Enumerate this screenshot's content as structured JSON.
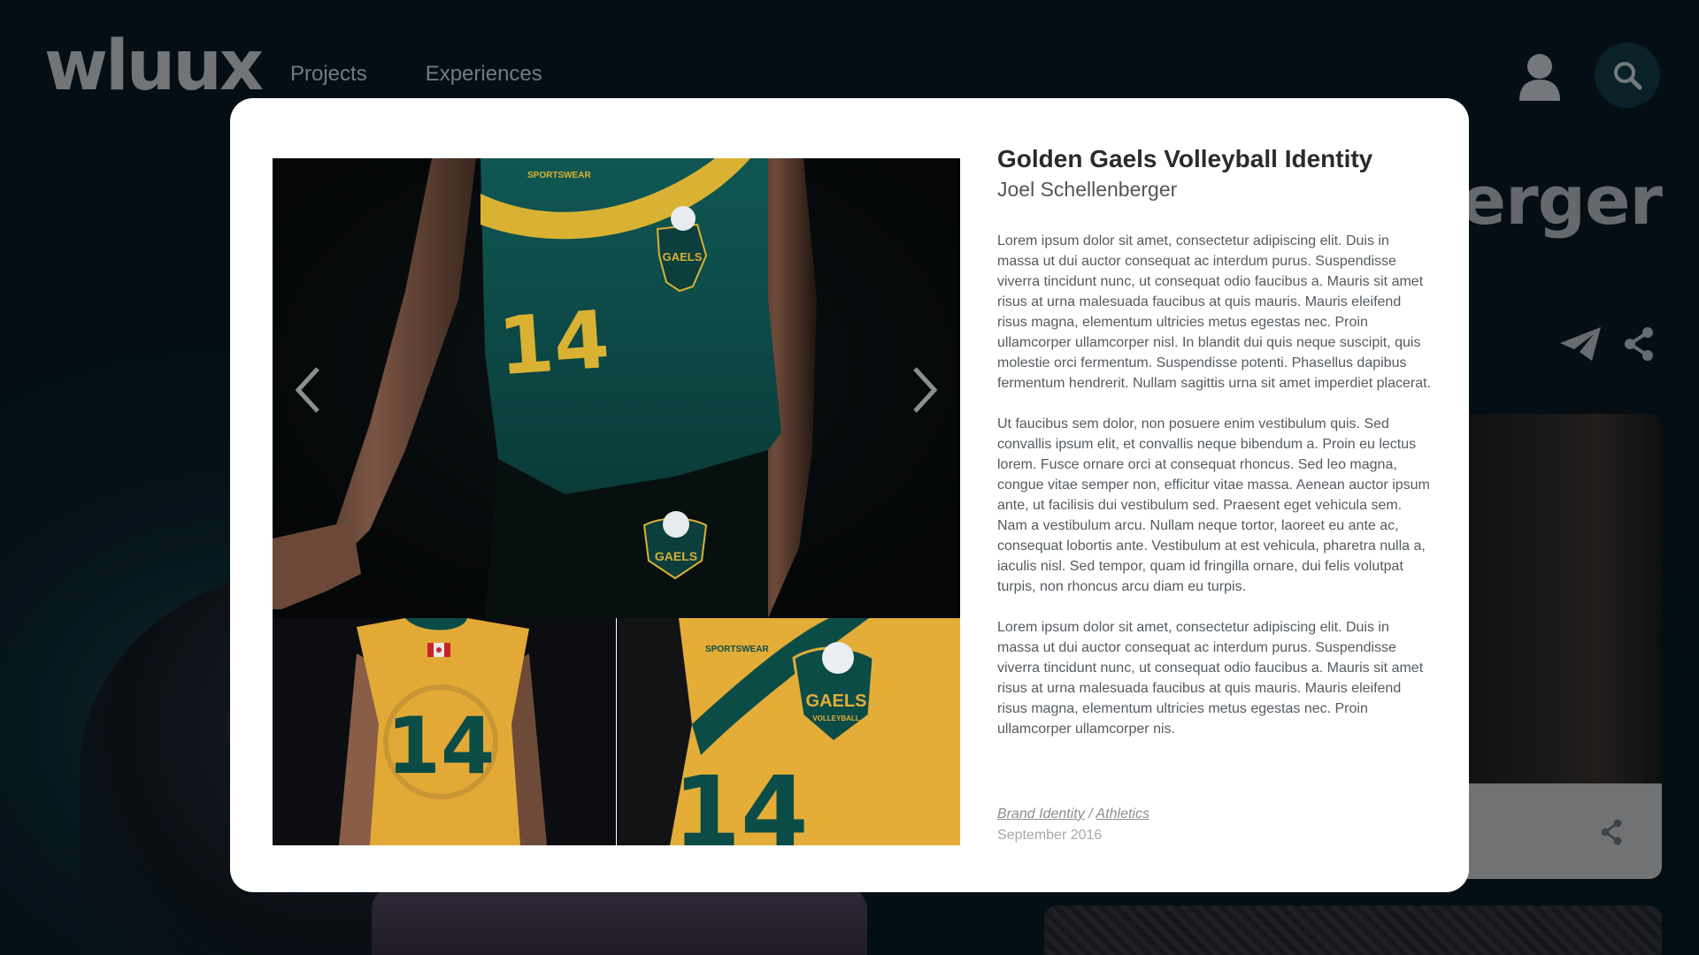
{
  "header": {
    "logo_text": "wluux",
    "nav": [
      {
        "label": "Projects"
      },
      {
        "label": "Experiences"
      }
    ]
  },
  "background": {
    "profile_name_fragment": "berger"
  },
  "modal": {
    "title": "Golden Gaels Volleyball Identity",
    "author": "Joel Schellenberger",
    "paragraphs": [
      "Lorem ipsum dolor sit amet, consectetur adipiscing elit. Duis in massa ut dui auctor consequat ac interdum purus. Suspendisse viverra tincidunt nunc, ut consequat odio faucibus a. Mauris sit amet risus at urna malesuada faucibus at quis mauris. Mauris eleifend risus magna, elementum ultricies metus egestas nec. Proin ullamcorper ullamcorper nisl. In blandit dui quis neque suscipit, quis molestie orci fermentum. Suspendisse potenti. Phasellus dapibus fermentum hendrerit. Nullam sagittis urna sit amet imperdiet placerat.",
      "Ut faucibus sem dolor, non posuere enim vestibulum quis. Sed convallis ipsum elit, et convallis neque bibendum a. Proin eu lectus lorem. Fusce ornare orci at consequat rhoncus. Sed leo magna, congue vitae semper non, efficitur vitae massa. Aenean auctor ipsum ante, ut facilisis dui vestibulum sed. Praesent eget vehicula sem. Nam a vestibulum arcu. Nullam neque tortor, laoreet eu ante ac, consequat lobortis ante. Vestibulum at est vehicula, pharetra nulla a, iaculis nisl. Sed tempor, quam id fringilla ornare, dui felis volutpat turpis, non rhoncus arcu diam eu turpis.",
      "Lorem ipsum dolor sit amet, consectetur adipiscing elit. Duis in massa ut dui auctor consequat ac interdum purus. Suspendisse viverra tincidunt nunc, ut consequat odio faucibus a. Mauris sit amet risus at urna malesuada faucibus at quis mauris. Mauris eleifend risus magna, elementum ultricies metus egestas nec. Proin ullamcorper ullamcorper nis."
    ],
    "tags": [
      "Brand Identity",
      "Athletics"
    ],
    "tag_separator": "/",
    "date": "September 2016",
    "gallery": {
      "main_jersey_number": "14",
      "thumb_left_jersey_number": "14",
      "thumb_right_jersey_number": "14",
      "crest_text": "GAELS",
      "crest_subtext": "VOLLEYBALL",
      "brand_text": "SPORTSWEAR"
    }
  },
  "colors": {
    "jersey_green": "#0b4a48",
    "jersey_gold": "#e9b23a",
    "page_bg": "#04111a",
    "modal_bg": "#ffffff"
  },
  "icons": {
    "user": "user-icon",
    "search": "search-icon",
    "send": "send-icon",
    "share": "share-icon",
    "prev": "chevron-left-icon",
    "next": "chevron-right-icon"
  }
}
